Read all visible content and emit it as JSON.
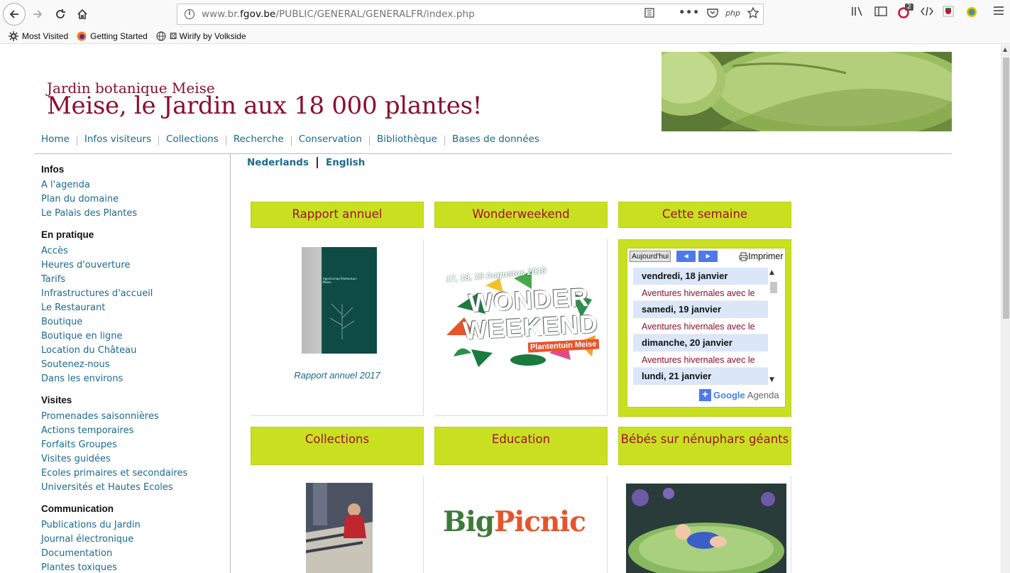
{
  "browser": {
    "url_prefix": "www.br.",
    "url_domain": "fgov.be",
    "url_path": "/PUBLIC/GENERAL/GENERALFR/index.php",
    "php_label": "php",
    "badge_count": "2"
  },
  "bookmarks": [
    {
      "label": "Most Visited",
      "icon": "gear-icon"
    },
    {
      "label": "Getting Started",
      "icon": "firefox-icon"
    },
    {
      "label": "⚄ Wirify by Volkside",
      "icon": "globe-icon"
    }
  ],
  "header": {
    "subtitle": "Jardin botanique Meise",
    "title": "Meise, le Jardin aux 18 000 plantes!"
  },
  "mainnav": [
    "Home",
    "Infos visiteurs",
    "Collections",
    "Recherche",
    "Conservation",
    "Bibliothèque",
    "Bases de données"
  ],
  "languages": [
    "Nederlands",
    "English"
  ],
  "sidebar": [
    {
      "heading": "Infos",
      "links": [
        "A l'agenda",
        "Plan du domaine",
        "Le Palais des Plantes"
      ]
    },
    {
      "heading": "En pratique",
      "links": [
        "Accès",
        "Heures d'ouverture",
        "Tarifs",
        "Infrastructures d'accueil",
        "Le Restaurant",
        "Boutique",
        "Boutique en ligne",
        "Location du Château",
        "Soutenez-nous",
        "Dans les environs"
      ]
    },
    {
      "heading": "Visites",
      "links": [
        "Promenades saisonnières",
        "Actions temporaires",
        "Forfaits Groupes",
        "Visites guidées",
        "Ecoles primaires et secondaires",
        "Universités et Hautes Ecoles"
      ]
    },
    {
      "heading": "Communication",
      "links": [
        "Publications du Jardin",
        "Journal électronique",
        "Documentation",
        "Plantes toxiques"
      ]
    }
  ],
  "tiles": {
    "rapport": {
      "title": "Rapport annuel",
      "caption": "Rapport annuel 2017",
      "book_text": "Agentschap Plantentuin Meise"
    },
    "wonder": {
      "title": "Wonderweekend",
      "dates": "17, 18, 19 Augustus 2018",
      "word1": "WONDER",
      "word2": "WEEKEND",
      "tag": "Plantentuin Meise"
    },
    "semaine": {
      "title": "Cette semaine"
    },
    "collections": {
      "title": "Collections"
    },
    "education": {
      "title": "Education",
      "logo_a": "Big",
      "logo_b": "Picnic"
    },
    "bebes": {
      "title": "Bébés sur nénuphars géants"
    }
  },
  "calendar": {
    "today": "Aujourd'hui",
    "print": "Imprimer",
    "days": [
      {
        "day": "vendredi, 18 janvier",
        "event": "Aventures hivernales avec le"
      },
      {
        "day": "samedi, 19 janvier",
        "event": "Aventures hivernales avec le"
      },
      {
        "day": "dimanche, 20 janvier",
        "event": "Aventures hivernales avec le"
      },
      {
        "day": "lundi, 21 janvier",
        "event": ""
      }
    ],
    "footer": "Agenda",
    "google": "Google"
  },
  "colors": {
    "brand": "#8b0e2e",
    "link": "#1a6a8f",
    "tile": "#c9e021",
    "tile_text": "#a0102d"
  }
}
